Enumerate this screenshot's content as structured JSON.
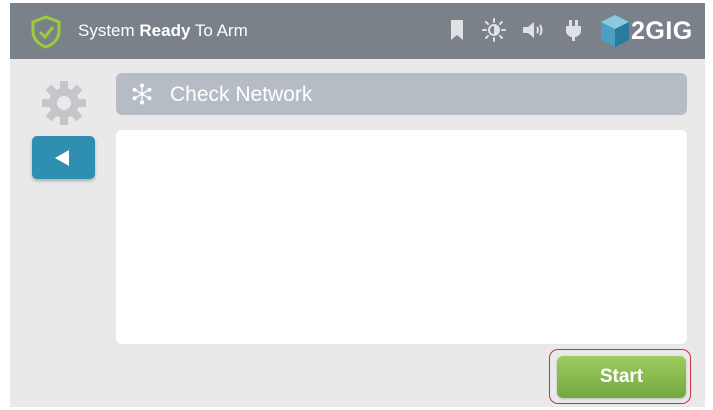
{
  "status_bar": {
    "status_prefix": "System ",
    "status_bold": "Ready",
    "status_suffix": " To Arm",
    "icons": [
      "shield-check-icon",
      "bookmark-icon",
      "brightness-icon",
      "volume-icon",
      "plug-icon"
    ],
    "logo": "2GIG"
  },
  "page": {
    "title": "Check Network",
    "title_icon": "network-icon"
  },
  "actions": {
    "start_label": "Start"
  },
  "colors": {
    "top_bar": "#7b8188",
    "back_button": "#2e8fb0",
    "start_button": "#8abc4f",
    "start_outline": "#c8313c",
    "title_bar": "#b6bcc4"
  }
}
